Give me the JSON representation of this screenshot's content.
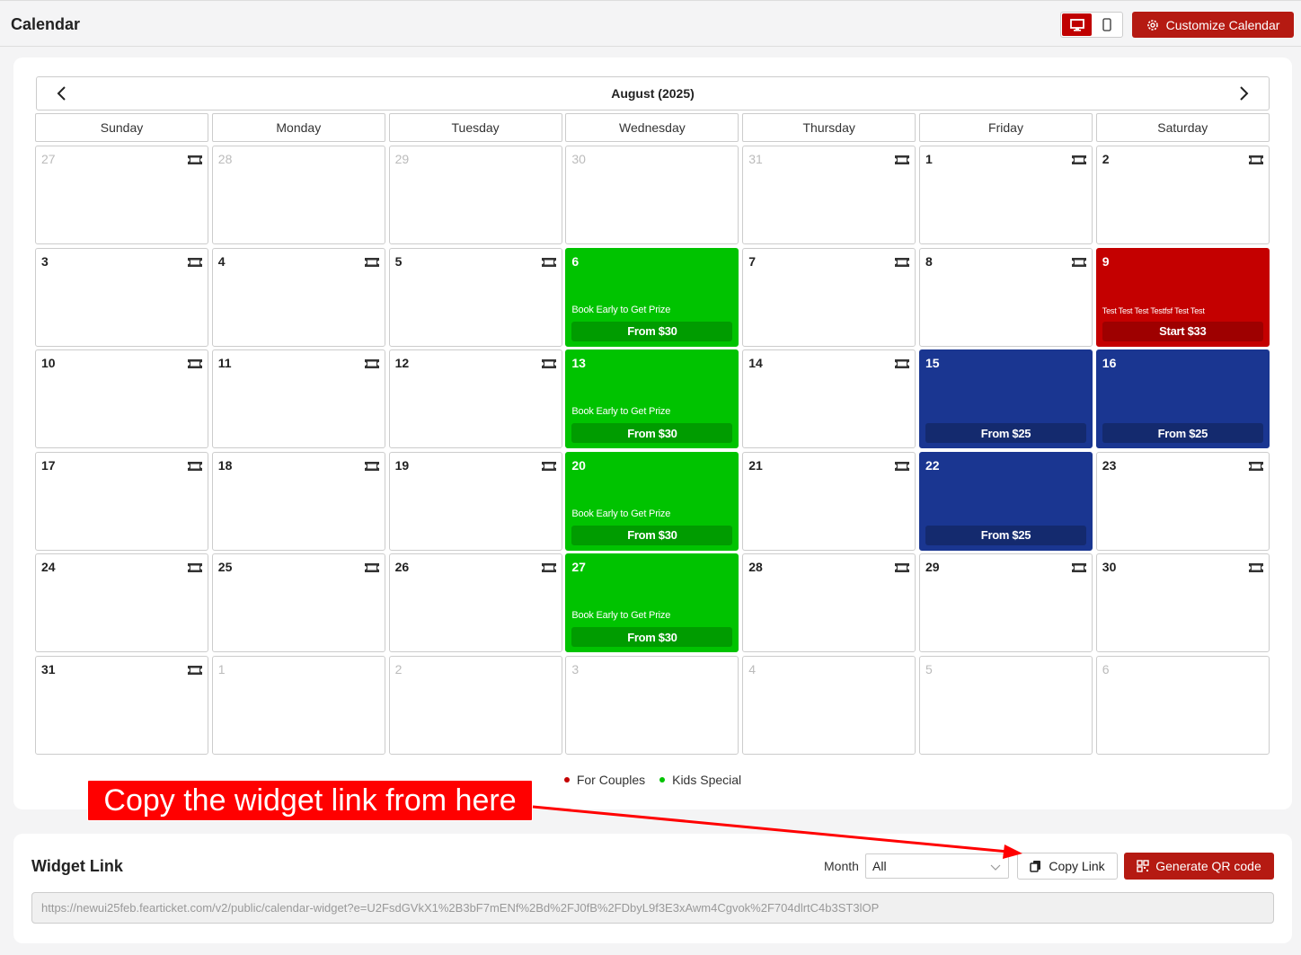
{
  "header": {
    "title": "Calendar",
    "customize_label": "Customize Calendar"
  },
  "calendar": {
    "month_title": "August (2025)",
    "weekdays": [
      "Sunday",
      "Monday",
      "Tuesday",
      "Wednesday",
      "Thursday",
      "Friday",
      "Saturday"
    ],
    "weeks": [
      [
        {
          "day": "27",
          "other": true,
          "ticket": true
        },
        {
          "day": "28",
          "other": true
        },
        {
          "day": "29",
          "other": true
        },
        {
          "day": "30",
          "other": true
        },
        {
          "day": "31",
          "other": true,
          "ticket": true
        },
        {
          "day": "1",
          "ticket": true
        },
        {
          "day": "2",
          "ticket": true
        }
      ],
      [
        {
          "day": "3",
          "ticket": true
        },
        {
          "day": "4",
          "ticket": true
        },
        {
          "day": "5",
          "ticket": true
        },
        {
          "day": "6",
          "event": "green",
          "title": "Book Early to Get Prize",
          "price": "From $30"
        },
        {
          "day": "7",
          "ticket": true
        },
        {
          "day": "8",
          "ticket": true
        },
        {
          "day": "9",
          "event": "red",
          "title": "Test Test Test Testfsf Test Test",
          "price": "Start $33"
        }
      ],
      [
        {
          "day": "10",
          "ticket": true
        },
        {
          "day": "11",
          "ticket": true
        },
        {
          "day": "12",
          "ticket": true
        },
        {
          "day": "13",
          "event": "green",
          "title": "Book Early to Get Prize",
          "price": "From $30"
        },
        {
          "day": "14",
          "ticket": true
        },
        {
          "day": "15",
          "event": "blue",
          "title": "",
          "price": "From $25"
        },
        {
          "day": "16",
          "event": "blue",
          "title": "",
          "price": "From $25"
        }
      ],
      [
        {
          "day": "17",
          "ticket": true
        },
        {
          "day": "18",
          "ticket": true
        },
        {
          "day": "19",
          "ticket": true
        },
        {
          "day": "20",
          "event": "green",
          "title": "Book Early to Get Prize",
          "price": "From $30"
        },
        {
          "day": "21",
          "ticket": true
        },
        {
          "day": "22",
          "event": "blue",
          "title": "",
          "price": "From $25"
        },
        {
          "day": "23",
          "ticket": true
        }
      ],
      [
        {
          "day": "24",
          "ticket": true
        },
        {
          "day": "25",
          "ticket": true
        },
        {
          "day": "26",
          "ticket": true
        },
        {
          "day": "27",
          "event": "green",
          "title": "Book Early to Get Prize",
          "price": "From $30"
        },
        {
          "day": "28",
          "ticket": true
        },
        {
          "day": "29",
          "ticket": true
        },
        {
          "day": "30",
          "ticket": true
        }
      ],
      [
        {
          "day": "31",
          "ticket": true
        },
        {
          "day": "1",
          "other": true
        },
        {
          "day": "2",
          "other": true
        },
        {
          "day": "3",
          "other": true
        },
        {
          "day": "4",
          "other": true
        },
        {
          "day": "5",
          "other": true
        },
        {
          "day": "6",
          "other": true
        }
      ]
    ],
    "legend": [
      {
        "label": "For Couples",
        "color": "#c40000"
      },
      {
        "label": "Kids Special",
        "color": "#00c300"
      }
    ]
  },
  "widget": {
    "title": "Widget Link",
    "month_label": "Month",
    "month_value": "All",
    "copy_label": "Copy Link",
    "qr_label": "Generate QR code",
    "url": "https://newui25feb.fearticket.com/v2/public/calendar-widget?e=U2FsdGVkX1%2B3bF7mENf%2Bd%2FJ0fB%2FDbyL9f3E3xAwm4Cgvok%2F704dlrtC4b3ST3lOP"
  },
  "annotation": {
    "text": "Copy the widget link from here"
  }
}
